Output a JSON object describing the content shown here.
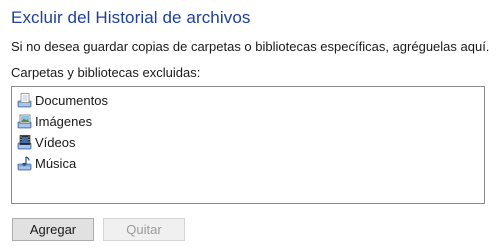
{
  "dialog": {
    "title": "Excluir del Historial de archivos",
    "description": "Si no desea guardar copias de carpetas o bibliotecas específicas, agréguelas aquí.",
    "list_label": "Carpetas y bibliotecas excluidas:"
  },
  "excluded_items": [
    {
      "label": "Documentos",
      "icon": "documents-library-icon"
    },
    {
      "label": "Imágenes",
      "icon": "pictures-library-icon"
    },
    {
      "label": "Vídeos",
      "icon": "videos-library-icon"
    },
    {
      "label": "Música",
      "icon": "music-library-icon"
    }
  ],
  "buttons": {
    "add_label": "Agregar",
    "remove_label": "Quitar",
    "remove_enabled": false
  },
  "colors": {
    "title": "#1e3f9a",
    "text": "#1a1a1a",
    "disabled_text": "#9a9a9a",
    "list_border": "#8a8a8a",
    "button_face": "#e1e1e1"
  }
}
